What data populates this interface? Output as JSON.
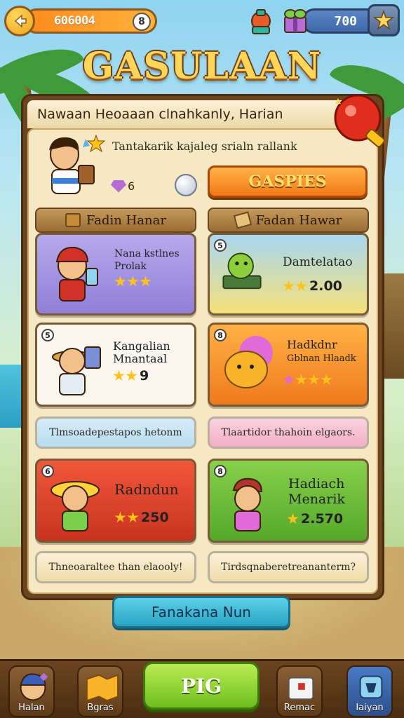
{
  "topbar": {
    "coins": "606004",
    "coin_badge": "8",
    "gold": "700"
  },
  "title": "GASULAAN",
  "panel": {
    "header": "Nawaan Heoaaan clnahkanly, Harian",
    "profile_text": "Tantakarik kajaleg srialn rallank",
    "gem_count": "6",
    "primary_button": "GASPIES"
  },
  "sections": [
    {
      "label": "Fadin Hanar"
    },
    {
      "label": "Fadan Hawar"
    }
  ],
  "cards": [
    {
      "num": "",
      "name": "Nana kstlnes Prolak",
      "value": "",
      "stars": 3
    },
    {
      "num": "5",
      "name": "Damtelatao",
      "value": "2.00",
      "stars": 2
    },
    {
      "num": "5",
      "name": "Kangalian Mnantaal",
      "value": "9",
      "stars": 2
    },
    {
      "num": "8",
      "name": "Hadkdnr",
      "subname": "Gblnan Hlaadk",
      "value": "",
      "stars": 4
    },
    {
      "num": "6",
      "name": "Radndun",
      "value": "250",
      "stars": 2
    },
    {
      "num": "8",
      "name": "Hadiach Menarik",
      "value": "2.570",
      "stars": 1
    }
  ],
  "strips": [
    "Tlmsoadepestapos hetonm",
    "Tlaartidor thahoin elgaors.",
    "Thneoaraltee than elaooly!",
    "Tirdsqnaberetreananterm?"
  ],
  "bottom_button": "Fanakana Nun",
  "nav": {
    "items": [
      "Halan",
      "Bgras",
      "Remac",
      "Iaiyan"
    ],
    "play": "PIG"
  },
  "colors": {
    "accent": "#f07a16",
    "panel_bg": "#f6e8c3",
    "play": "#6fbe1e"
  }
}
